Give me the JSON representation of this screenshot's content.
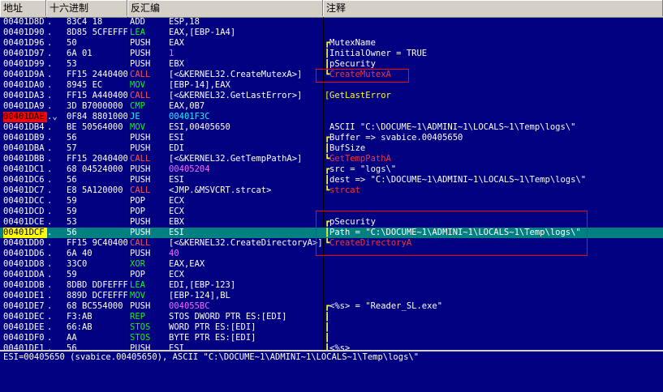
{
  "headers": {
    "address": "地址",
    "hex": "十六进制",
    "disassembly": "反汇编",
    "comment": "注释"
  },
  "rows": [
    {
      "addr": "00401D8D",
      "mark": ".",
      "hex": "83C4 18",
      "mnemonic": "ADD",
      "operand": "ESP,18",
      "kind": "add",
      "bracket": "",
      "comment": ""
    },
    {
      "addr": "00401D90",
      "mark": ".",
      "hex": "8D85 5CFEFFFF",
      "mnemonic": "LEA",
      "operand": "EAX,[EBP-1A4]",
      "kind": "lea",
      "bracket": "",
      "comment": ""
    },
    {
      "addr": "00401D96",
      "mark": ".",
      "hex": "50",
      "mnemonic": "PUSH",
      "operand": "EAX",
      "kind": "push",
      "bracket": "┏",
      "comment": "MutexName"
    },
    {
      "addr": "00401D97",
      "mark": ".",
      "hex": "6A 01",
      "mnemonic": "PUSH",
      "operand": "1",
      "kind": "push",
      "bracket": "┃",
      "comment": "InitialOwner = TRUE"
    },
    {
      "addr": "00401D99",
      "mark": ".",
      "hex": "53",
      "mnemonic": "PUSH",
      "operand": "EBX",
      "kind": "push",
      "bracket": "┃",
      "comment": "pSecurity"
    },
    {
      "addr": "00401D9A",
      "mark": ".",
      "hex": "FF15 24404000",
      "mnemonic": "CALL",
      "operand": "[<&KERNEL32.CreateMutexA>]",
      "kind": "call",
      "bracket": "┗",
      "comment": "CreateMutexA",
      "comment_style": "red"
    },
    {
      "addr": "00401DA0",
      "mark": ".",
      "hex": "8945 EC",
      "mnemonic": "MOV",
      "operand": "[EBP-14],EAX",
      "kind": "mov",
      "bracket": "",
      "comment": ""
    },
    {
      "addr": "00401DA3",
      "mark": ".",
      "hex": "FF15 A4404000",
      "mnemonic": "CALL",
      "operand": "[<&KERNEL32.GetLastError>]",
      "kind": "call",
      "bracket": "[",
      "comment": "GetLastError",
      "comment_style": "fn"
    },
    {
      "addr": "00401DA9",
      "mark": ".",
      "hex": "3D B7000000",
      "mnemonic": "CMP",
      "operand": "EAX,0B7",
      "kind": "cmp",
      "bracket": "",
      "comment": ""
    },
    {
      "addr": "00401DAE",
      "mark": ".⌄",
      "hex": "0F84 88010000",
      "mnemonic": "JE",
      "operand": "00401F3C",
      "kind": "jmp",
      "bracket": "",
      "comment": "",
      "highlight": "brk"
    },
    {
      "addr": "00401DB4",
      "mark": ".",
      "hex": "BE 50564000",
      "mnemonic": "MOV",
      "operand": "ESI,00405650",
      "kind": "mov",
      "bracket": "",
      "comment": "ASCII \"C:\\DOCUME~1\\ADMINI~1\\LOCALS~1\\Temp\\logs\\\""
    },
    {
      "addr": "00401DB9",
      "mark": ".",
      "hex": "56",
      "mnemonic": "PUSH",
      "operand": "ESI",
      "kind": "push",
      "bracket": "┏",
      "comment": "Buffer => svabice.00405650"
    },
    {
      "addr": "00401DBA",
      "mark": ".",
      "hex": "57",
      "mnemonic": "PUSH",
      "operand": "EDI",
      "kind": "push",
      "bracket": "┃",
      "comment": "BufSize"
    },
    {
      "addr": "00401DBB",
      "mark": ".",
      "hex": "FF15 20404000",
      "mnemonic": "CALL",
      "operand": "[<&KERNEL32.GetTempPathA>]",
      "kind": "call",
      "bracket": "┗",
      "comment": "GetTempPathA",
      "comment_style": "red"
    },
    {
      "addr": "00401DC1",
      "mark": ".",
      "hex": "68 04524000",
      "mnemonic": "PUSH",
      "operand": "00405204",
      "kind": "push",
      "bracket": "┏",
      "comment": "src = \"logs\\\""
    },
    {
      "addr": "00401DC6",
      "mark": ".",
      "hex": "56",
      "mnemonic": "PUSH",
      "operand": "ESI",
      "kind": "push",
      "bracket": "┃",
      "comment": "dest => \"C:\\DOCUME~1\\ADMINI~1\\LOCALS~1\\Temp\\logs\\\""
    },
    {
      "addr": "00401DC7",
      "mark": ".",
      "hex": "E8 5A120000",
      "mnemonic": "CALL",
      "operand": "<JMP.&MSVCRT.strcat>",
      "kind": "call",
      "bracket": "┗",
      "comment": "strcat",
      "comment_style": "red"
    },
    {
      "addr": "00401DCC",
      "mark": ".",
      "hex": "59",
      "mnemonic": "POP",
      "operand": "ECX",
      "kind": "pop",
      "bracket": "",
      "comment": ""
    },
    {
      "addr": "00401DCD",
      "mark": ".",
      "hex": "59",
      "mnemonic": "POP",
      "operand": "ECX",
      "kind": "pop",
      "bracket": "",
      "comment": ""
    },
    {
      "addr": "00401DCE",
      "mark": ".",
      "hex": "53",
      "mnemonic": "PUSH",
      "operand": "EBX",
      "kind": "push",
      "bracket": "┏",
      "comment": "pSecurity"
    },
    {
      "addr": "00401DCF",
      "mark": ".",
      "hex": "56",
      "mnemonic": "PUSH",
      "operand": "ESI",
      "kind": "push",
      "bracket": "┃",
      "comment": "Path = \"C:\\DOCUME~1\\ADMINI~1\\LOCALS~1\\Temp\\logs\\\"",
      "highlight": "cur"
    },
    {
      "addr": "00401DD0",
      "mark": ".",
      "hex": "FF15 9C404000",
      "mnemonic": "CALL",
      "operand": "[<&KERNEL32.CreateDirectoryA>]",
      "kind": "call",
      "bracket": "┗",
      "comment": "CreateDirectoryA",
      "comment_style": "red"
    },
    {
      "addr": "00401DD6",
      "mark": ".",
      "hex": "6A 40",
      "mnemonic": "PUSH",
      "operand": "40",
      "kind": "push",
      "bracket": "",
      "comment": ""
    },
    {
      "addr": "00401DD8",
      "mark": ".",
      "hex": "33C0",
      "mnemonic": "XOR",
      "operand": "EAX,EAX",
      "kind": "xor",
      "bracket": "",
      "comment": ""
    },
    {
      "addr": "00401DDA",
      "mark": ".",
      "hex": "59",
      "mnemonic": "POP",
      "operand": "ECX",
      "kind": "pop",
      "bracket": "",
      "comment": ""
    },
    {
      "addr": "00401DDB",
      "mark": ".",
      "hex": "8DBD DDFEFFFF",
      "mnemonic": "LEA",
      "operand": "EDI,[EBP-123]",
      "kind": "lea",
      "bracket": "",
      "comment": ""
    },
    {
      "addr": "00401DE1",
      "mark": ".",
      "hex": "889D DCFEFFFF",
      "mnemonic": "MOV",
      "operand": "[EBP-124],BL",
      "kind": "mov",
      "bracket": "",
      "comment": ""
    },
    {
      "addr": "00401DE7",
      "mark": ".",
      "hex": "68 BC554000",
      "mnemonic": "PUSH",
      "operand": "004055BC",
      "kind": "push",
      "bracket": "┏",
      "comment": "<%s> = \"Reader_SL.exe\""
    },
    {
      "addr": "00401DEC",
      "mark": ".",
      "hex": "F3:AB",
      "mnemonic": "REP",
      "operand": "STOS DWORD PTR ES:[EDI]",
      "kind": "rep",
      "bracket": "┃",
      "comment": ""
    },
    {
      "addr": "00401DEE",
      "mark": ".",
      "hex": "66:AB",
      "mnemonic": "STOS",
      "operand": "WORD PTR ES:[EDI]",
      "kind": "stos",
      "bracket": "┃",
      "comment": ""
    },
    {
      "addr": "00401DF0",
      "mark": ".",
      "hex": "AA",
      "mnemonic": "STOS",
      "operand": "BYTE PTR ES:[EDI]",
      "kind": "stos",
      "bracket": "┃",
      "comment": ""
    },
    {
      "addr": "00401DF1",
      "mark": ".",
      "hex": "56",
      "mnemonic": "PUSH",
      "operand": "ESI",
      "kind": "push",
      "bracket": "┃",
      "comment": "<%s>"
    }
  ],
  "info_line": "ESI=00405650 (svabice.00405650), ASCII \"C:\\DOCUME~1\\ADMINI~1\\LOCALS~1\\Temp\\logs\\\"",
  "colors": {
    "background": "#000080",
    "header": "#d4d0c8",
    "current_row": "#008080",
    "current_addr": "#ffff00",
    "breakpoint_addr": "#ff0000",
    "annotation_box": "#ff0000"
  }
}
